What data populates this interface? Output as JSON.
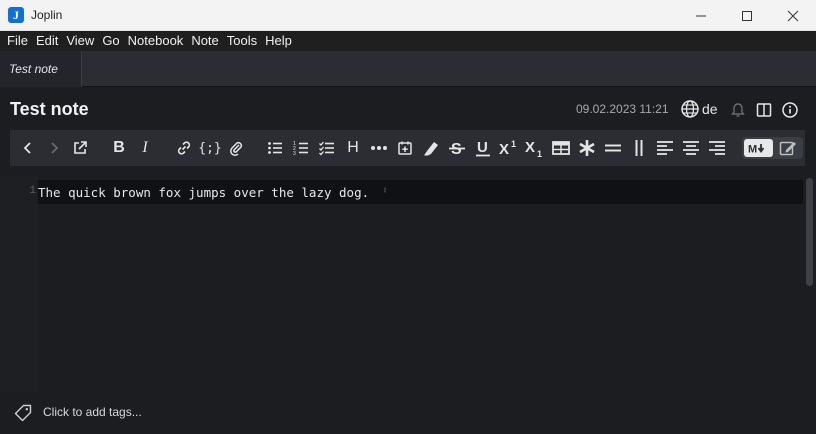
{
  "window": {
    "title": "Joplin"
  },
  "menu": [
    "File",
    "Edit",
    "View",
    "Go",
    "Notebook",
    "Note",
    "Tools",
    "Help"
  ],
  "tab": {
    "label": "Test note"
  },
  "note": {
    "title": "Test note",
    "date": "09.02.2023 11:21",
    "language": "de"
  },
  "editor": {
    "line_number": "1",
    "line_text": "The quick brown fox jumps over the lazy dog."
  },
  "footer": {
    "tags_placeholder": "Click to add tags..."
  },
  "toolbar": {
    "buttons": [
      "back",
      "forward",
      "external-edit",
      "bold",
      "italic",
      "link",
      "code",
      "attach",
      "bulleted-list",
      "numbered-list",
      "checkbox-list",
      "heading",
      "horizontal-rule",
      "insert-time",
      "highlight",
      "strikethrough",
      "underline",
      "superscript",
      "subscript",
      "table",
      "asterisk",
      "equals",
      "column-divider",
      "align-left",
      "align-center",
      "align-right"
    ],
    "mode_markdown": "M↓",
    "active_mode": "markdown"
  },
  "colors": {
    "accent": "#1071d3",
    "background": "#1c1d20",
    "toolbar": "#2b2d33"
  }
}
